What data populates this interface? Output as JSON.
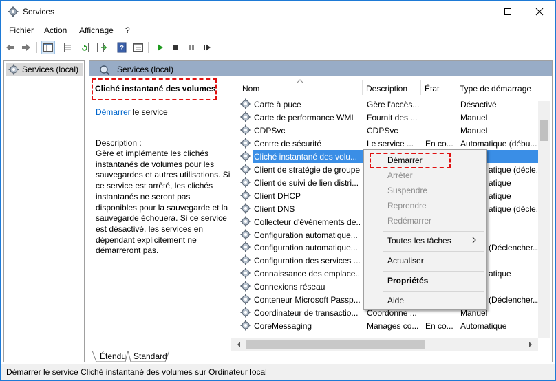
{
  "window": {
    "title": "Services"
  },
  "menubar": {
    "items": [
      "Fichier",
      "Action",
      "Affichage",
      "?"
    ]
  },
  "toolbar": {
    "icons": [
      "back-arrow-icon",
      "forward-arrow-icon",
      "console-tree-icon",
      "properties-icon",
      "refresh-icon",
      "export-icon",
      "help-icon",
      "view-icon",
      "play-icon",
      "stop-icon",
      "pause-icon",
      "restart-icon"
    ]
  },
  "tree": {
    "root_label": "Services (local)"
  },
  "panel": {
    "header_label": "Services (local)",
    "extended": {
      "service_name": "Cliché instantané des volumes",
      "link_text": "Démarrer",
      "link_suffix": " le service",
      "description_label": "Description :",
      "description": "Gère et implémente les clichés instantanés de volumes pour les sauvegardes et autres utilisations. Si ce service est arrêté, les clichés instantanés ne seront pas disponibles pour la sauvegarde et la sauvegarde échouera. Si ce service est désactivé, les services en dépendant explicitement ne démarreront pas."
    },
    "columns": {
      "name": "Nom",
      "description": "Description",
      "state": "État",
      "startup": "Type de démarrage"
    },
    "rows": [
      {
        "name": "Carte à puce",
        "description": "Gère l'accès...",
        "state": "",
        "startup": "Désactivé"
      },
      {
        "name": "Carte de performance WMI",
        "description": "Fournit des ...",
        "state": "",
        "startup": "Manuel"
      },
      {
        "name": "CDPSvc",
        "description": "CDPSvc",
        "state": "",
        "startup": "Manuel"
      },
      {
        "name": "Centre de sécurité",
        "description": "Le service ...",
        "state": "En co...",
        "startup": "Automatique (débu..."
      },
      {
        "name": "Cliché instantané des volu...",
        "description": "",
        "state": "",
        "startup": ""
      },
      {
        "name": "Client de stratégie de groupe",
        "description": "",
        "state": "",
        "startup": "atique (décle..."
      },
      {
        "name": "Client de suivi de lien distri...",
        "description": "",
        "state": "",
        "startup": "atique"
      },
      {
        "name": "Client DHCP",
        "description": "",
        "state": "",
        "startup": "atique"
      },
      {
        "name": "Client DNS",
        "description": "",
        "state": "",
        "startup": "atique (décle..."
      },
      {
        "name": "Collecteur d'événements de...",
        "description": "",
        "state": "",
        "startup": ""
      },
      {
        "name": "Configuration automatique...",
        "description": "",
        "state": "",
        "startup": ""
      },
      {
        "name": "Configuration automatique...",
        "description": "",
        "state": "",
        "startup": "(Déclencher..."
      },
      {
        "name": "Configuration des services ...",
        "description": "",
        "state": "",
        "startup": ""
      },
      {
        "name": "Connaissance des emplace...",
        "description": "",
        "state": "",
        "startup": "atique"
      },
      {
        "name": "Connexions réseau",
        "description": "",
        "state": "",
        "startup": ""
      },
      {
        "name": "Conteneur Microsoft Passp...",
        "description": "",
        "state": "",
        "startup": "(Déclencher..."
      },
      {
        "name": "Coordinateur de transactio...",
        "description": "Coordonne ...",
        "state": "",
        "startup": "Manuel"
      },
      {
        "name": "CoreMessaging",
        "description": "Manages co...",
        "state": "En co...",
        "startup": "Automatique"
      }
    ],
    "selected_row_index": 4,
    "tabs": [
      "Étendu",
      "Standard"
    ]
  },
  "context_menu": {
    "items": [
      {
        "label": "Démarrer",
        "disabled": false,
        "bold": false
      },
      {
        "label": "Arrêter",
        "disabled": true,
        "bold": false
      },
      {
        "label": "Suspendre",
        "disabled": true,
        "bold": false
      },
      {
        "label": "Reprendre",
        "disabled": true,
        "bold": false
      },
      {
        "label": "Redémarrer",
        "disabled": true,
        "bold": false
      },
      {
        "label": "Toutes les tâches",
        "disabled": false,
        "bold": false,
        "submenu": true
      },
      {
        "label": "Actualiser",
        "disabled": false,
        "bold": false
      },
      {
        "label": "Propriétés",
        "disabled": false,
        "bold": true
      },
      {
        "label": "Aide",
        "disabled": false,
        "bold": false
      }
    ]
  },
  "statusbar": {
    "text": "Démarrer le service Cliché instantané des volumes sur Ordinateur local"
  },
  "colors": {
    "header": "#98acc6",
    "selection": "#3a8ee6",
    "highlight": "#e01010",
    "link": "#0066cc"
  }
}
